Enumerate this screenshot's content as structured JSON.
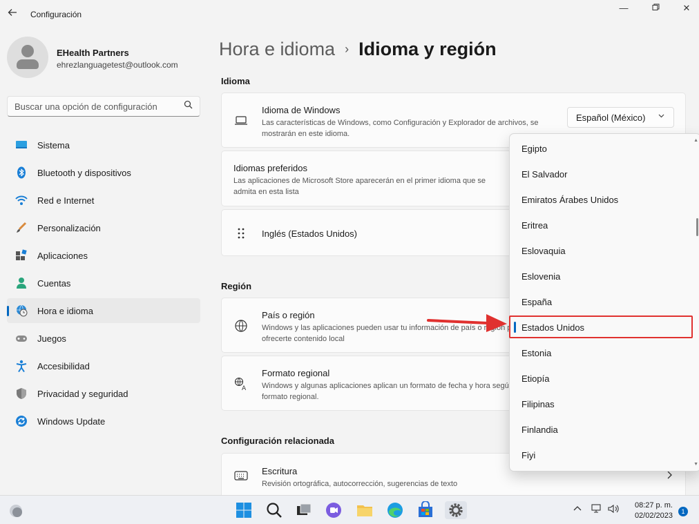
{
  "app": {
    "title": "Configuración"
  },
  "window_controls": {
    "minimize": "—",
    "maximize": "▢",
    "close": "✕"
  },
  "profile": {
    "name": "EHealth Partners",
    "email": "ehrezlanguagetest@outlook.com"
  },
  "search": {
    "placeholder": "Buscar una opción de configuración"
  },
  "sidebar": {
    "items": [
      {
        "label": "Sistema",
        "icon": "monitor-icon"
      },
      {
        "label": "Bluetooth y dispositivos",
        "icon": "bluetooth-icon"
      },
      {
        "label": "Red e Internet",
        "icon": "wifi-icon"
      },
      {
        "label": "Personalización",
        "icon": "brush-icon"
      },
      {
        "label": "Aplicaciones",
        "icon": "apps-icon"
      },
      {
        "label": "Cuentas",
        "icon": "person-icon"
      },
      {
        "label": "Hora e idioma",
        "icon": "globe-clock-icon",
        "active": true
      },
      {
        "label": "Juegos",
        "icon": "gamepad-icon"
      },
      {
        "label": "Accesibilidad",
        "icon": "accessibility-icon"
      },
      {
        "label": "Privacidad y seguridad",
        "icon": "shield-icon"
      },
      {
        "label": "Windows Update",
        "icon": "update-icon"
      }
    ]
  },
  "breadcrumb": {
    "parent": "Hora e idioma",
    "separator": "›",
    "current": "Idioma y región"
  },
  "sections": {
    "language": {
      "title": "Idioma",
      "windows_language": {
        "title": "Idioma de Windows",
        "desc": "Las características de Windows, como Configuración y Explorador de archivos, se mostrarán en este idioma.",
        "value": "Español (México)"
      },
      "preferred": {
        "title": "Idiomas preferidos",
        "desc": "Las aplicaciones de Microsoft Store aparecerán en el primer idioma que se admita en esta lista"
      },
      "english": {
        "label": "Inglés (Estados Unidos)"
      }
    },
    "region": {
      "title": "Región",
      "country": {
        "title": "País o región",
        "desc": "Windows y las aplicaciones pueden usar tu información de país o región para ofrecerte contenido local"
      },
      "format": {
        "title": "Formato regional",
        "desc": "Windows y algunas aplicaciones aplican un formato de fecha y hora según su formato regional."
      }
    },
    "related": {
      "title": "Configuración relacionada",
      "typing": {
        "title": "Escritura",
        "desc": "Revisión ortográfica, autocorrección, sugerencias de texto"
      }
    }
  },
  "dropdown": {
    "items": [
      "Egipto",
      "El Salvador",
      "Emiratos Árabes Unidos",
      "Eritrea",
      "Eslovaquia",
      "Eslovenia",
      "España",
      "Estados Unidos",
      "Estonia",
      "Etiopía",
      "Filipinas",
      "Finlandia",
      "Fiyi"
    ],
    "selected": "Estados Unidos"
  },
  "taskbar": {
    "time": "08:27 p. m.",
    "date": "02/02/2023",
    "notification_count": "1"
  },
  "colors": {
    "accent": "#0067c0",
    "highlight": "#e0312f"
  }
}
